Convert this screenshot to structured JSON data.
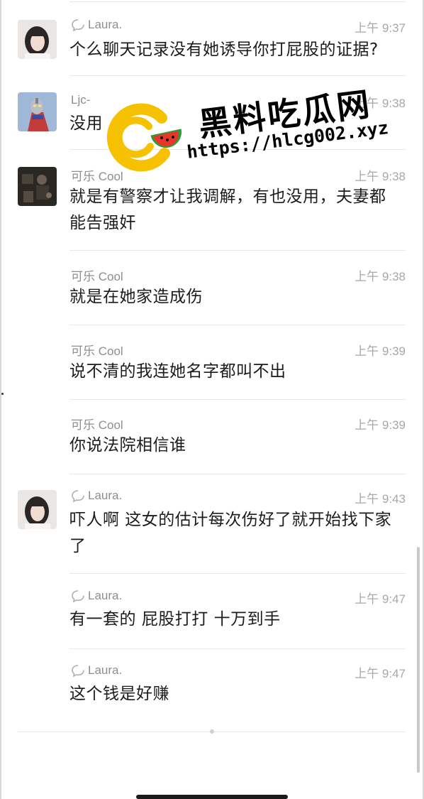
{
  "messages": [
    {
      "sender": "Laura.",
      "time": "上午 9:37",
      "text": "个么聊天记录没有她诱导你打屁股的证据?",
      "avatar": "girl-photo-avatar",
      "show_avatar": true
    },
    {
      "sender": "Ljc-",
      "time": "上午 9:38",
      "text": "没用",
      "avatar": "ultraman-avatar",
      "show_avatar": true
    },
    {
      "sender": "可乐 Cool",
      "time": "上午 9:38",
      "text": "就是有警察才让我调解，有也没用，夫妻都能告强奸",
      "avatar": "dark-photo-avatar",
      "show_avatar": true
    },
    {
      "sender": "可乐 Cool",
      "time": "上午 9:38",
      "text": "就是在她家造成伤",
      "show_avatar": false
    },
    {
      "sender": "可乐 Cool",
      "time": "上午 9:39",
      "text": "说不清的我连她名字都叫不出",
      "show_avatar": false
    },
    {
      "sender": "可乐 Cool",
      "time": "上午 9:39",
      "text": "你说法院相信谁",
      "show_avatar": false
    },
    {
      "sender": "Laura.",
      "time": "上午 9:43",
      "text": "吓人啊   这女的估计每次伤好了就开始找下家了",
      "avatar": "girl-photo-avatar",
      "show_avatar": true
    },
    {
      "sender": "Laura.",
      "time": "上午 9:47",
      "text": "有一套的  屁股打打   十万到手",
      "show_avatar": false
    },
    {
      "sender": "Laura.",
      "time": "上午 9:47",
      "text": "这个钱是好赚",
      "show_avatar": false
    }
  ],
  "watermark": {
    "title": "黑料吃瓜网",
    "url": "https://hlcg002.xyz",
    "logo": "watermelon-logo-icon",
    "colors": {
      "ring": "#f5c100",
      "melon_red": "#e8362a",
      "melon_green": "#2e9a3a"
    }
  },
  "colors": {
    "text": "#1c1c1c",
    "meta": "#a8a8a8",
    "divider": "#e8e8e8"
  }
}
